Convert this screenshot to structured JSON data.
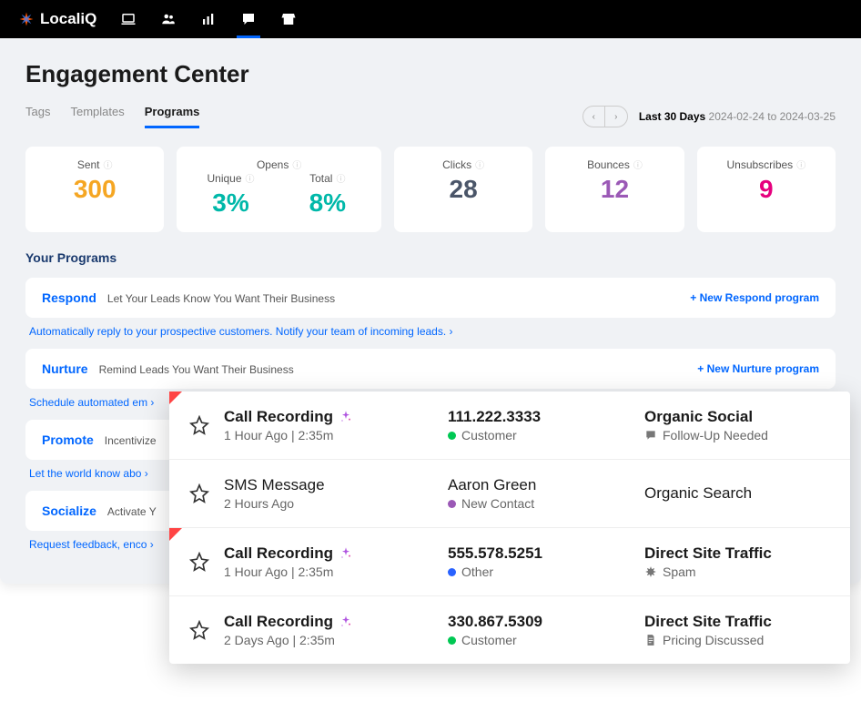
{
  "brand": "LocaliQ",
  "page_title": "Engagement Center",
  "tabs": [
    "Tags",
    "Templates",
    "Programs"
  ],
  "active_tab": 2,
  "date": {
    "label": "Last 30 Days",
    "range": "2024-02-24 to 2024-03-25"
  },
  "stats": {
    "sent": {
      "label": "Sent",
      "value": "300"
    },
    "opens": {
      "label": "Opens",
      "unique_label": "Unique",
      "unique_value": "3%",
      "total_label": "Total",
      "total_value": "8%"
    },
    "clicks": {
      "label": "Clicks",
      "value": "28"
    },
    "bounces": {
      "label": "Bounces",
      "value": "12"
    },
    "unsubs": {
      "label": "Unsubscribes",
      "value": "9"
    }
  },
  "section_title": "Your Programs",
  "programs": [
    {
      "name": "Respond",
      "desc": "Let Your Leads Know You Want Their Business",
      "action": "New Respond program",
      "sublink": "Automatically reply to your prospective customers. Notify your team of incoming leads."
    },
    {
      "name": "Nurture",
      "desc": "Remind Leads You Want Their Business",
      "action": "New Nurture program",
      "sublink": "Schedule automated em"
    },
    {
      "name": "Promote",
      "desc": "Incentivize",
      "action": "",
      "sublink": "Let the world know abo"
    },
    {
      "name": "Socialize",
      "desc": "Activate Y",
      "action": "",
      "sublink": "Request feedback, enco"
    }
  ],
  "leads": [
    {
      "corner": true,
      "title": "Call Recording",
      "sparkle": true,
      "sub": "1 Hour Ago | 2:35m",
      "contact": "111.222.3333",
      "contact_bold": true,
      "status_dot": "green",
      "status": "Customer",
      "source": "Organic Social",
      "source_bold": true,
      "tag_icon": "chat",
      "tag": "Follow-Up Needed"
    },
    {
      "corner": false,
      "title": "SMS Message",
      "sparkle": false,
      "sub": "2 Hours Ago",
      "contact": "Aaron Green",
      "contact_bold": false,
      "status_dot": "purple",
      "status": "New Contact",
      "source": "Organic Search",
      "source_bold": false,
      "tag_icon": "",
      "tag": ""
    },
    {
      "corner": true,
      "title": "Call Recording",
      "sparkle": true,
      "sub": "1 Hour Ago | 2:35m",
      "contact": "555.578.5251",
      "contact_bold": true,
      "status_dot": "blue",
      "status": "Other",
      "source": "Direct Site Traffic",
      "source_bold": true,
      "tag_icon": "spam",
      "tag": "Spam"
    },
    {
      "corner": false,
      "title": "Call Recording",
      "sparkle": true,
      "sub": "2 Days Ago | 2:35m",
      "contact": "330.867.5309",
      "contact_bold": true,
      "status_dot": "green",
      "status": "Customer",
      "source": "Direct Site Traffic",
      "source_bold": true,
      "tag_icon": "doc",
      "tag": "Pricing Discussed"
    }
  ]
}
